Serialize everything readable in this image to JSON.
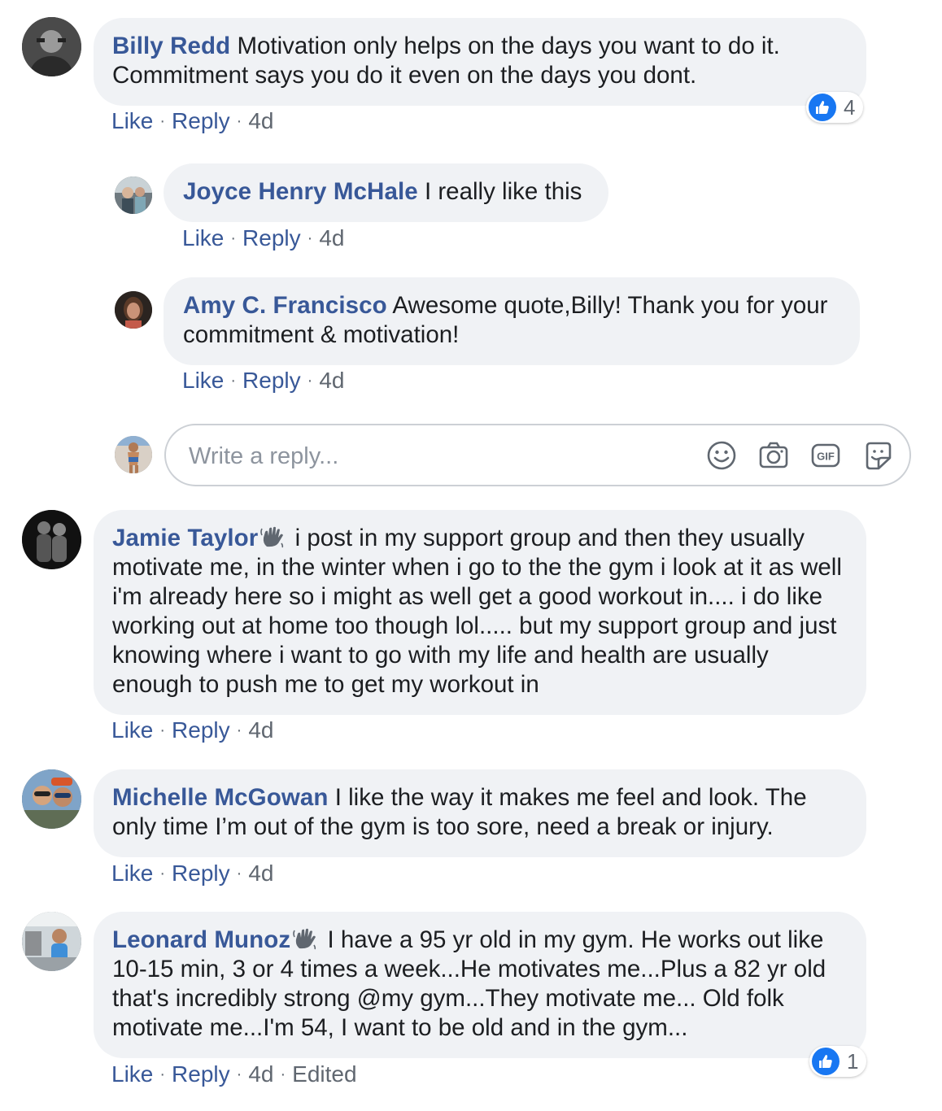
{
  "comments": [
    {
      "author": "Billy Redd",
      "text": "Motivation only helps on the days you want to do it. Commitment says you do it even on the days you dont.",
      "like": "Like",
      "reply": "Reply",
      "time": "4d",
      "reaction_count": "4"
    },
    {
      "author": "Joyce Henry McHale",
      "text": "I really like this",
      "like": "Like",
      "reply": "Reply",
      "time": "4d"
    },
    {
      "author": "Amy C. Francisco",
      "text": "Awesome quote,Billy! Thank you for your commitment & motivation!",
      "like": "Like",
      "reply": "Reply",
      "time": "4d"
    },
    {
      "author": "Jamie Taylor",
      "text": "i post in my support group and then they usually motivate me, in the winter when i go to the the gym i look at it as well i'm already here so i might as well get a good workout in.... i do like working out at home too though lol..... but my support group and just knowing where i want to go with my life and health are usually enough to push me to get my workout in",
      "like": "Like",
      "reply": "Reply",
      "time": "4d"
    },
    {
      "author": "Michelle McGowan",
      "text": "I like the way it makes me feel and look. The only time I’m out of the gym is too sore, need a break or injury.",
      "like": "Like",
      "reply": "Reply",
      "time": "4d"
    },
    {
      "author": "Leonard Munoz",
      "text": "I have a 95 yr old in my gym. He works out like 10-15 min, 3 or 4 times a week...He motivates me...Plus a 82 yr old that's incredibly strong @my gym...They motivate me... Old folk motivate me...I'm 54, I want to be old and in the gym...",
      "like": "Like",
      "reply": "Reply",
      "time": "4d",
      "edited": "Edited",
      "reaction_count": "1"
    }
  ],
  "composer": {
    "placeholder": "Write a reply...",
    "tools": [
      "emoji-icon",
      "camera-icon",
      "gif-icon",
      "sticker-icon"
    ]
  },
  "colors": {
    "bubble": "#f0f2f5",
    "author": "#385898",
    "meta": "#606770",
    "like_blue": "#1877f2"
  }
}
